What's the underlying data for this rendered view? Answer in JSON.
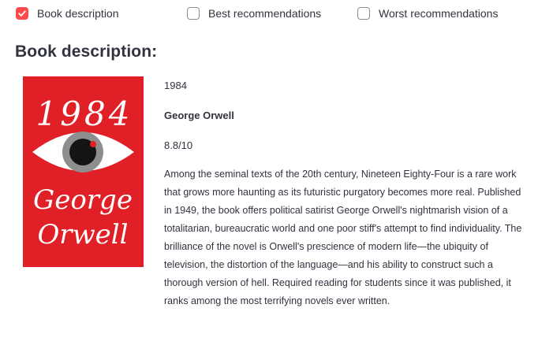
{
  "options": {
    "book_description": {
      "label": "Book description",
      "checked": true
    },
    "best_recommendations": {
      "label": "Best recommendations",
      "checked": false
    },
    "worst_recommendations": {
      "label": "Worst recommendations",
      "checked": false
    }
  },
  "section": {
    "heading": "Book description:"
  },
  "book": {
    "cover": {
      "title_text": "1984",
      "author_line1": "George",
      "author_line2": "Orwell",
      "background_color": "#e02026",
      "icon": "eye-illustration"
    },
    "title": "1984",
    "author": "George Orwell",
    "rating": "8.8/10",
    "description": "Among the seminal texts of the 20th century, Nineteen Eighty-Four is a rare work that grows more haunting as its futuristic purgatory becomes more real. Published in 1949, the book offers political satirist George Orwell's nightmarish vision of a totalitarian, bureaucratic world and one poor stiff's attempt to find individuality. The brilliance of the novel is Orwell's prescience of modern life—the ubiquity of television, the distortion of the language—and his ability to construct such a thorough version of hell. Required reading for students since it was published, it ranks among the most terrifying novels ever written."
  },
  "colors": {
    "accent": "#ff4b4b",
    "text": "#31333f"
  }
}
